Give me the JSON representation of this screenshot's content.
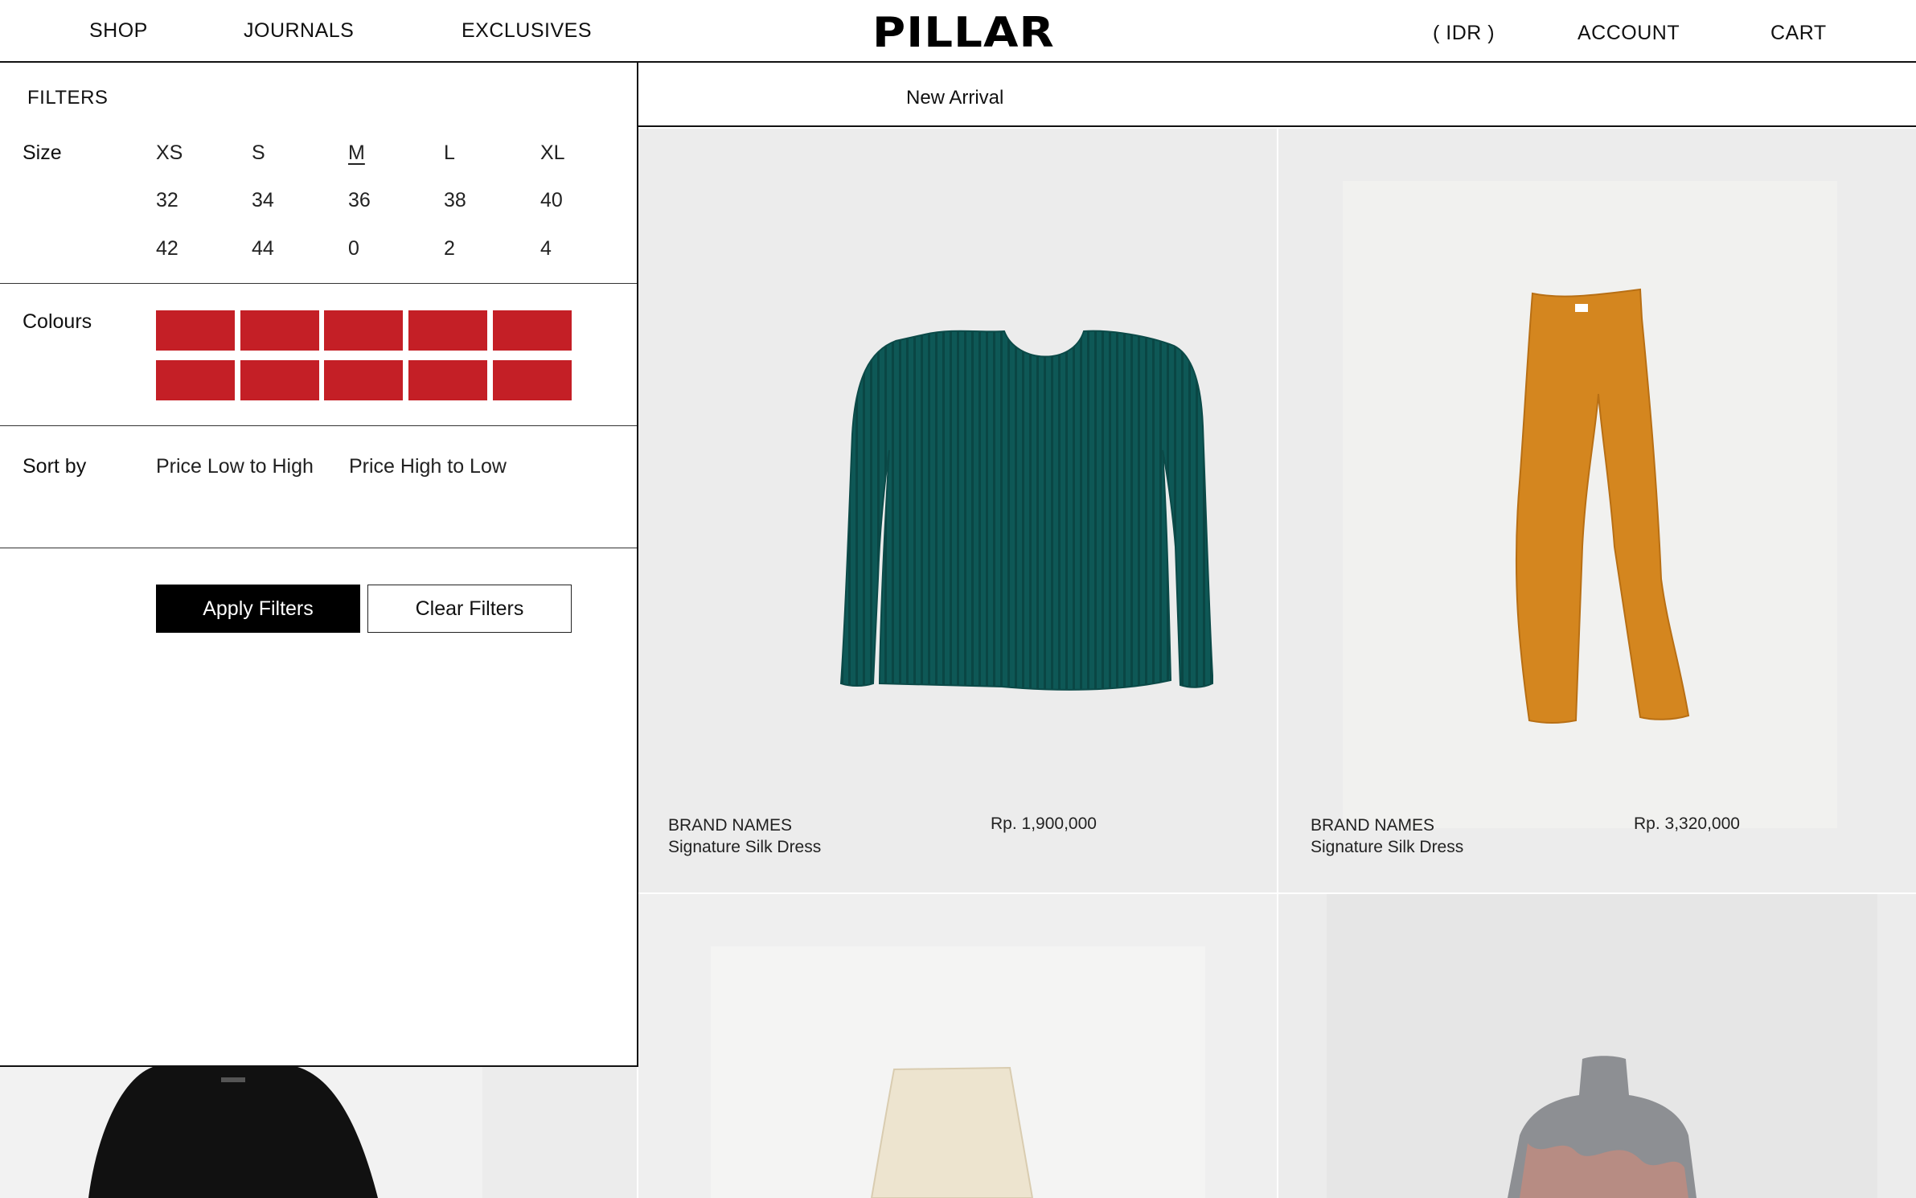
{
  "header": {
    "nav": [
      "SHOP",
      "JOURNALS",
      "EXCLUSIVES"
    ],
    "logo": "PILLAR",
    "currency": "( IDR )",
    "account": "ACCOUNT",
    "cart": "CART"
  },
  "filters": {
    "title": "FILTERS",
    "size": {
      "label": "Size",
      "options": [
        "XS",
        "S",
        "M",
        "L",
        "XL",
        "32",
        "34",
        "36",
        "38",
        "40",
        "42",
        "44",
        "0",
        "2",
        "4"
      ],
      "selected": "M"
    },
    "colours": {
      "label": "Colours",
      "swatches": [
        "#c41f26",
        "#c41f26",
        "#c41f26",
        "#c41f26",
        "#c41f26",
        "#c41f26",
        "#c41f26",
        "#c41f26",
        "#c41f26",
        "#c41f26"
      ]
    },
    "sort": {
      "label": "Sort by",
      "options": [
        "Price Low to High",
        "Price High to Low"
      ]
    },
    "apply_label": "Apply Filters",
    "clear_label": "Clear Filters"
  },
  "section": {
    "title": "New Arrival"
  },
  "products": [
    {
      "brand": "BRAND NAMES",
      "name": "Signature Silk Dress",
      "price": "Rp. 1,900,000",
      "color": "#0d5654"
    },
    {
      "brand": "BRAND NAMES",
      "name": "Signature Silk Dress",
      "price": "Rp. 3,320,000",
      "color": "#d4861f"
    }
  ],
  "colors": {
    "accent": "#c41f26",
    "card_bg": "#ececec"
  }
}
